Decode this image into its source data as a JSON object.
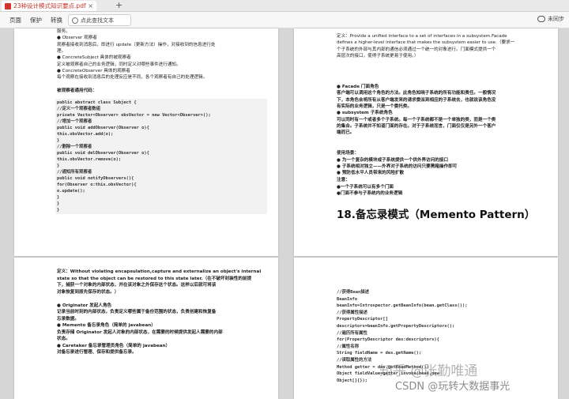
{
  "tab": {
    "title": "23种设计模式知识要点.pdf",
    "close": "×",
    "new": "+"
  },
  "toolbar": {
    "items": [
      "页面",
      "保护",
      "转换"
    ],
    "search_placeholder": "点此查找文本",
    "cloud": "未同步"
  },
  "page1": {
    "lines": [
      {
        "text": "服务。",
        "bold": false
      },
      {
        "text": "● Observer 观察者",
        "bold": false
      },
      {
        "text": "观察者接收到消息后，即进行 update（更新方法）操作，对接收到的信息进行处",
        "bold": false
      },
      {
        "text": "理。",
        "bold": false
      },
      {
        "text": "● ConcreteSubject 具体的被观察者",
        "bold": false
      },
      {
        "text": "定义被观察者自己的业务逻辑，同时定义对哪些事件进行通知。",
        "bold": false
      },
      {
        "text": "● ConcreteObserver 具体的观察者",
        "bold": false
      },
      {
        "text": "每个观察在接收到消息后的处理反应是不同，各个观察者有自己的处理逻辑。",
        "bold": false
      },
      {
        "text": "",
        "bold": false
      },
      {
        "text": "被观察者通用代码：",
        "bold": true
      }
    ],
    "code": [
      "public abstract class Subject {",
      "     //定义一个观察者数组",
      "     private Vector<Observer> obsVector = new Vector<Observer>();",
      "     //增加一个观察者",
      "     public void addObserver(Observer o){",
      "             this.obsVector.add(o);",
      "     }",
      "     //删除一个观察者",
      "     public void delObserver(Observer o){",
      "             this.obsVector.remove(o);",
      "     }",
      "     //通知所有观察者",
      "     public void notifyObservers(){",
      "             for(Observer o:this.obsVector){",
      "                     o.update();",
      "             }",
      "     }",
      "}"
    ]
  },
  "page2": {
    "top": [
      {
        "text": "定义：Provide a unified interface to a set of interfaces in a subsystem.Facade",
        "bold": false,
        "lead": "定义："
      },
      {
        "text": "defines a higher-level interface that makes the subsystem easier to use.（要求一",
        "bold": false
      },
      {
        "text": "个子系统的外部与其内部的通信必须通过一个统一的对象进行。门面模式提供一个",
        "bold": false
      },
      {
        "text": "高层次的接口，使得子系统更易于使用。）",
        "bold": false
      }
    ],
    "mid": [
      "● Facade 门面角色",
      "客户端可以调用这个角色的方法。此角色知晓子系统的所有功能和责任。一般情况",
      "下，本角色会将所有从客户端发来的请求委派到相应的子系统去，也就说该角色没",
      "有实际的业务逻辑，只是一个委托类。",
      "● subsystem 子系统角色",
      "可以同时有一个或者多个子系统。每一个子系统都不是一个单独的类，而是一个类",
      "的集合。子系统并不知道门面的存在。对于子系统而言，门面仅仅是另外一个客户",
      "端而已。"
    ],
    "usage_title": "使用场景：",
    "usage": [
      "● 为一个复杂的模块或子系统提供一个供外界访问的接口",
      "● 子系统相对独立——外界对子系统的访问只要黑箱操作即可",
      "● 预防低水平人员带来的风险扩散"
    ],
    "notes_title": "注意：",
    "notes": [
      "●一个子系统可以有多个门面",
      "●门面不参与子系统内的业务逻辑"
    ],
    "heading": "18.备忘录模式（Memento Pattern）"
  },
  "page3": {
    "lines": [
      "定义：Without violating encapsulation,capture and externalize an object's internal",
      "state so that the object can be restored to this state later.（在不破坏封装性的前提",
      "下，捕获一个对象的内部状态，并在该对象之外保存这个状态。这样以后就可将该",
      "对象恢复到原先保存的状态。）",
      "",
      "● Originator 发起人角色",
      "记录当前时刻的内部状态，负责定义哪些属于备份范围的状态，负责创建和恢复备",
      "忘录数据。",
      "● Memento 备忘录角色（简单的 javabean）",
      "负责存储 Originator 发起人对象的内部状态，在需要的时候提供发起人需要的内部",
      "状态。",
      "● Caretaker 备忘录管理员角色（简单的 javabean）",
      "对备忘录进行管理、保存和提供备忘录。"
    ]
  },
  "page4": {
    "code": [
      "                //获得Bean描述",
      "                BeanInfo",
      "beanInfo=Introspector.getBeanInfo(bean.getClass());",
      "                //获得属性描述",
      "                PropertyDescriptor[]",
      "descriptors=beanInfo.getPropertyDescriptors();",
      "                //遍历所有属性",
      "                for(PropertyDescriptor des:descriptors){",
      "                        //属性名称",
      "                        String fieldName = des.getName();",
      "                        //读取属性的方法",
      "                        Method getter = des.getReadMethod();",
      "                        Object fieldValue=getter.invoke(bean,new",
      "Object[]{});"
    ]
  },
  "watermark": {
    "zhihu": "知乎 @张勤唯通",
    "csdn": "CSDN @玩转大数据事光"
  },
  "colors": {
    "accent": "#d2352b"
  }
}
